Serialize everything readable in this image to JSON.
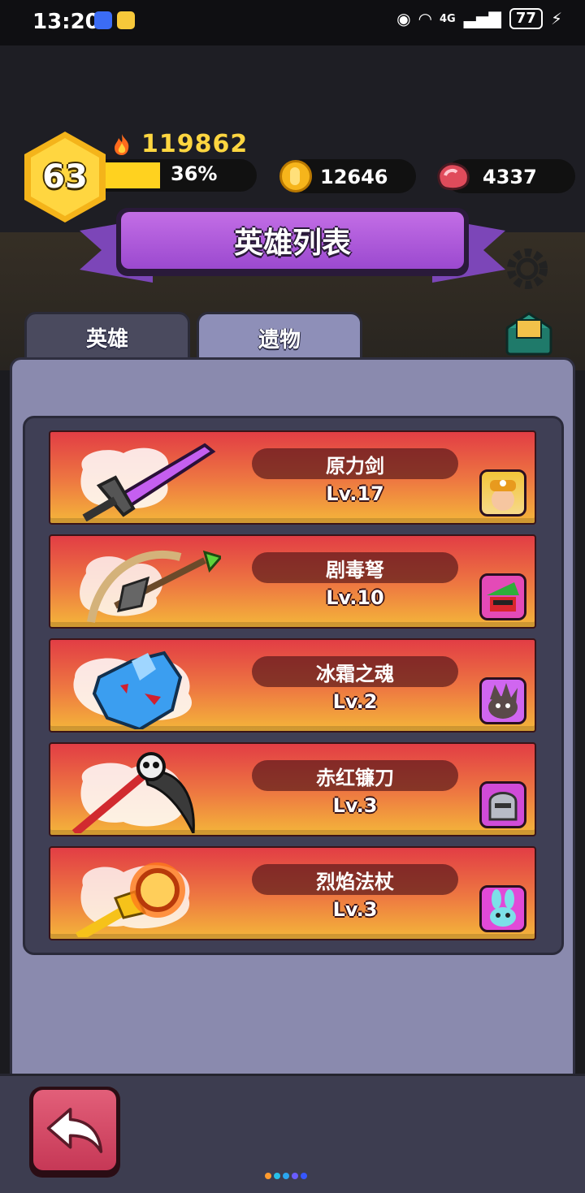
{
  "status_bar": {
    "time": "13:20",
    "network": "4G",
    "battery": "77"
  },
  "player": {
    "level": "63",
    "power": "119862",
    "xp_percent": 36,
    "xp_label": "36%",
    "gold": "12646",
    "meat": "4337"
  },
  "title": "英雄列表",
  "tabs": [
    {
      "label": "英雄",
      "active": false
    },
    {
      "label": "遗物",
      "active": true
    }
  ],
  "relics": [
    {
      "name": "原力剑",
      "level": "Lv.17",
      "icon": "sword-icon",
      "hero": "miner-hero-avatar"
    },
    {
      "name": "剧毒弩",
      "level": "Lv.10",
      "icon": "crossbow-icon",
      "hero": "robin-hero-avatar"
    },
    {
      "name": "冰霜之魂",
      "level": "Lv.2",
      "icon": "ice-crystal-icon",
      "hero": "shadow-hero-avatar"
    },
    {
      "name": "赤红镰刀",
      "level": "Lv.3",
      "icon": "scythe-icon",
      "hero": "knight-hero-avatar"
    },
    {
      "name": "烈焰法杖",
      "level": "Lv.3",
      "icon": "fire-staff-icon",
      "hero": "bunny-hero-avatar"
    }
  ],
  "colors": {
    "accent": "#9b49cf",
    "panel": "#8a8aae",
    "card_top": "#e23d45",
    "card_bottom": "#f4b63a",
    "back_button": "#c63856"
  },
  "page_dots": [
    "#ff9a2e",
    "#27c0e8",
    "#2ba6f0",
    "#6a5cff",
    "#3657ff"
  ]
}
